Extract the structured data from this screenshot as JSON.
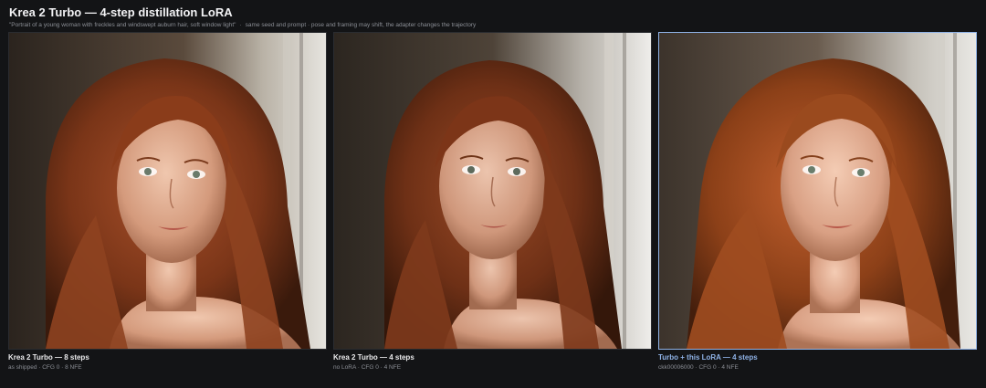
{
  "header": {
    "title": "Krea 2 Turbo — 4-step distillation LoRA",
    "prompt": "\"Portrait of a young woman with freckles and windswept auburn hair, soft window light\"",
    "note": "same seed and prompt · pose and framing may shift, the adapter changes the trajectory"
  },
  "panels": [
    {
      "title": "Krea 2 Turbo — 8 steps",
      "subtitle": "as shipped · CFG 0 · 8 NFE",
      "image_alt": "portrait of a young woman with auburn hair by a window",
      "highlight": false
    },
    {
      "title": "Krea 2 Turbo — 4 steps",
      "subtitle": "no LoRA · CFG 0 · 4 NFE",
      "image_alt": "portrait of a young woman with auburn hair by a window",
      "highlight": false
    },
    {
      "title": "Turbo + this LoRA — 4 steps",
      "subtitle": "ckk00006000 · CFG 0 · 4 NFE",
      "image_alt": "portrait of a young woman with auburn hair by a window",
      "highlight": true
    }
  ],
  "colors": {
    "background": "#131416",
    "highlight": "#8fb2e6",
    "caption_muted": "#8c8f96"
  }
}
